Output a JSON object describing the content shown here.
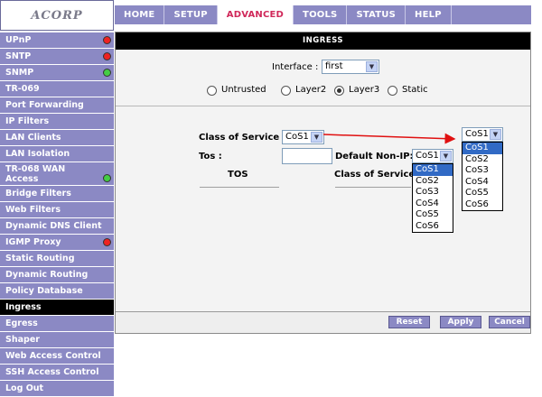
{
  "logo": {
    "text": "ACORP"
  },
  "topnav": [
    {
      "label": "HOME"
    },
    {
      "label": "SETUP"
    },
    {
      "label": "ADVANCED",
      "active": true
    },
    {
      "label": "TOOLS"
    },
    {
      "label": "STATUS"
    },
    {
      "label": "HELP"
    }
  ],
  "sidebar": [
    {
      "label": "UPnP",
      "status": "red"
    },
    {
      "label": "SNTP",
      "status": "red"
    },
    {
      "label": "SNMP",
      "status": "green"
    },
    {
      "label": "TR-069"
    },
    {
      "label": "Port Forwarding"
    },
    {
      "label": "IP Filters"
    },
    {
      "label": "LAN Clients"
    },
    {
      "label": "LAN Isolation"
    },
    {
      "label": "TR-068 WAN Access",
      "status": "green",
      "tall": true
    },
    {
      "label": "Bridge Filters"
    },
    {
      "label": "Web Filters"
    },
    {
      "label": "Dynamic DNS Client"
    },
    {
      "label": "IGMP Proxy",
      "status": "red"
    },
    {
      "label": "Static Routing"
    },
    {
      "label": "Dynamic Routing"
    },
    {
      "label": "Policy Database"
    },
    {
      "label": "Ingress",
      "active": true
    },
    {
      "label": "Egress"
    },
    {
      "label": "Shaper"
    },
    {
      "label": "Web Access Control"
    },
    {
      "label": "SSH Access Control"
    },
    {
      "label": "Log Out"
    }
  ],
  "page": {
    "title": "INGRESS",
    "interface_label": "Interface :",
    "interface_value": "first",
    "radios": [
      {
        "label": "Untrusted",
        "checked": false
      },
      {
        "label": "Layer2",
        "checked": false
      },
      {
        "label": "Layer3",
        "checked": true
      },
      {
        "label": "Static",
        "checked": false
      }
    ],
    "cos_label": "Class of Service :",
    "cos_value": "CoS1",
    "tos_label": "Tos :",
    "default_nonip_label": "Default Non-IP:",
    "default_nonip_value": "CoS1",
    "tos_header": "TOS",
    "cos_header": "Class of Service",
    "options": [
      "CoS1",
      "CoS2",
      "CoS3",
      "CoS4",
      "CoS5",
      "CoS6"
    ],
    "callout_value": "CoS1"
  },
  "buttons": {
    "reset": "Reset",
    "apply": "Apply",
    "cancel": "Cancel"
  },
  "colors": {
    "nav": "#8b89c4",
    "active_tab_text": "#d0285a",
    "arrow": "#e01010"
  }
}
